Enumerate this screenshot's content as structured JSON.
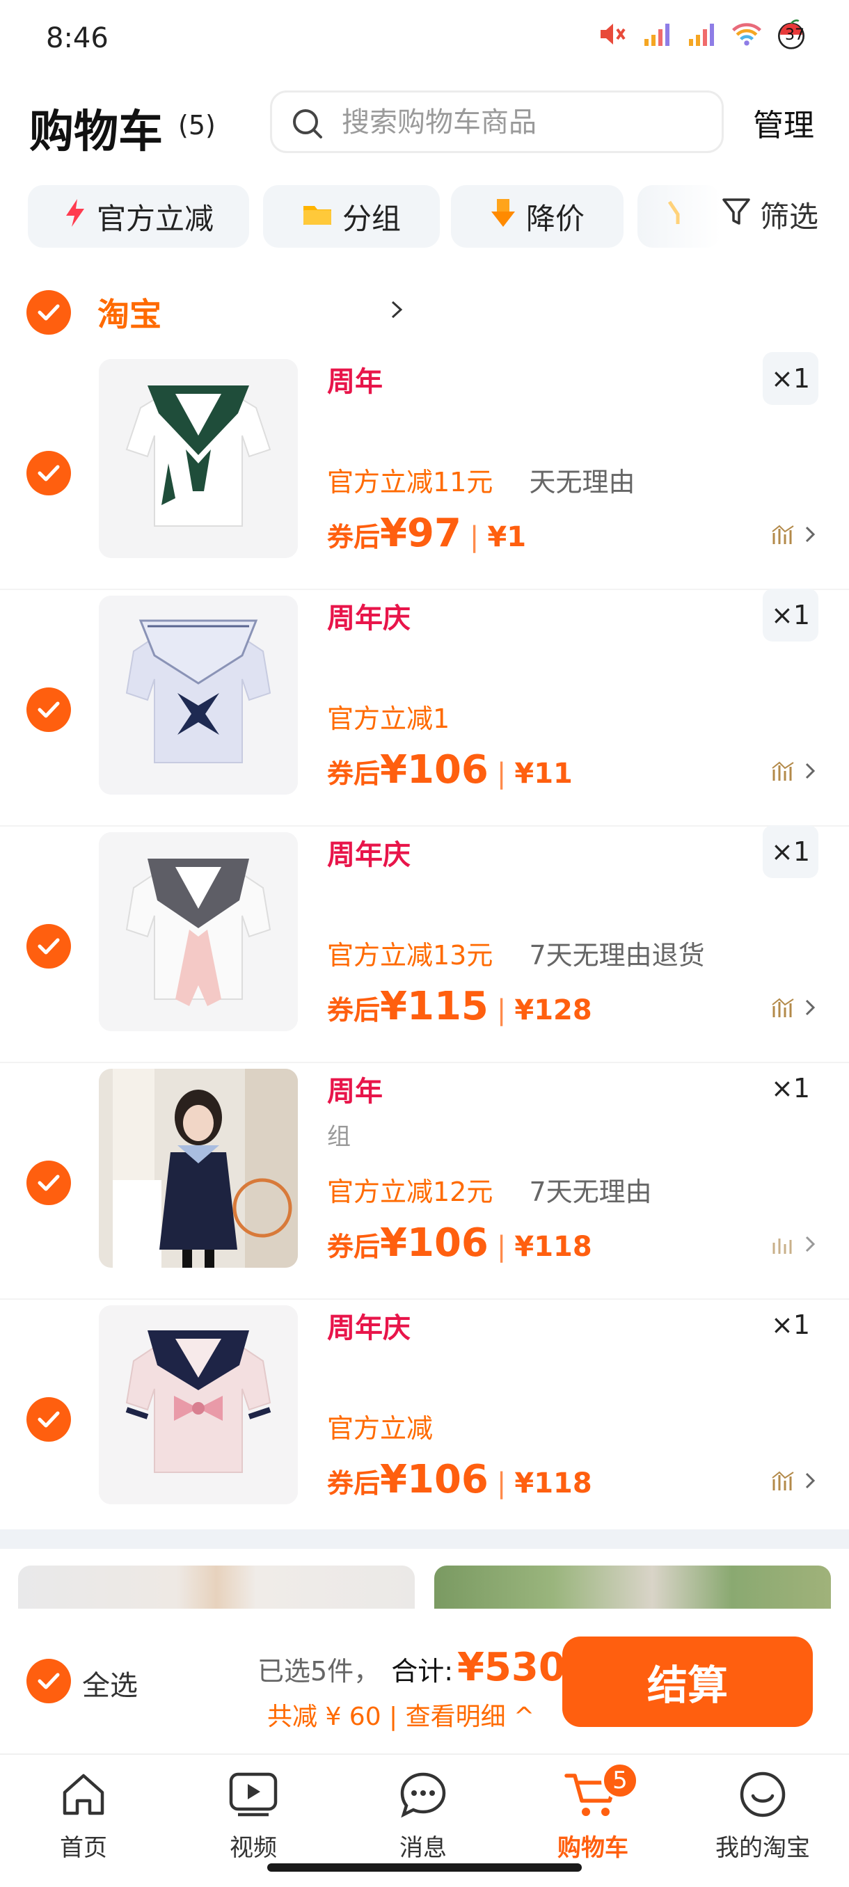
{
  "status_bar": {
    "time": "8:46",
    "battery_label": "37"
  },
  "header": {
    "title": "购物车",
    "count": "(5)",
    "search_placeholder": "搜索购物车商品",
    "manage": "管理"
  },
  "chips": [
    {
      "label": "官方立减",
      "icon": "lightning-icon"
    },
    {
      "label": "分组",
      "icon": "folder-icon"
    },
    {
      "label": "降价",
      "icon": "price-down-icon"
    }
  ],
  "filter_label": "筛选",
  "store": {
    "name": "淘宝"
  },
  "items": [
    {
      "name": "周年",
      "sub": "",
      "promo": "官方立减11元",
      "return_policy": "天无理由",
      "price_label": "券后",
      "price": "¥97",
      "original": "¥1",
      "qty": "×1"
    },
    {
      "name": "周年庆",
      "sub": "",
      "promo": "官方立减1",
      "return_policy": "",
      "price_label": "券后",
      "price": "¥106",
      "original": "¥11",
      "qty": "×1"
    },
    {
      "name": "周年庆",
      "sub": "",
      "promo": "官方立减13元",
      "return_policy": "7天无理由退货",
      "price_label": "券后",
      "price": "¥115",
      "original": "¥128",
      "qty": "×1"
    },
    {
      "name": "周年",
      "sub": "组",
      "promo": "官方立减12元",
      "return_policy": "7天无理由",
      "price_label": "券后",
      "price": "¥106",
      "original": "¥118",
      "qty": "×1"
    },
    {
      "name": "周年庆",
      "sub": "",
      "promo": "官方立减",
      "return_policy": "",
      "price_label": "券后",
      "price": "¥106",
      "original": "¥118",
      "qty": "×1"
    }
  ],
  "checkout": {
    "select_all": "全选",
    "selected": "已选5件，",
    "total_label": "合计:",
    "total": "¥530",
    "savings": "共减 ¥ 60 | 查看明细 ^",
    "pay": "结算"
  },
  "tabs": [
    {
      "label": "首页",
      "icon": "home-icon"
    },
    {
      "label": "视频",
      "icon": "video-icon"
    },
    {
      "label": "消息",
      "icon": "message-icon"
    },
    {
      "label": "购物车",
      "icon": "cart-icon",
      "badge": "5",
      "active": true
    },
    {
      "label": "我的淘宝",
      "icon": "profile-icon"
    }
  ],
  "colors": {
    "accent": "#ff5f0f",
    "brand_red": "#e8154a",
    "chip_bg": "#f2f5f8"
  }
}
